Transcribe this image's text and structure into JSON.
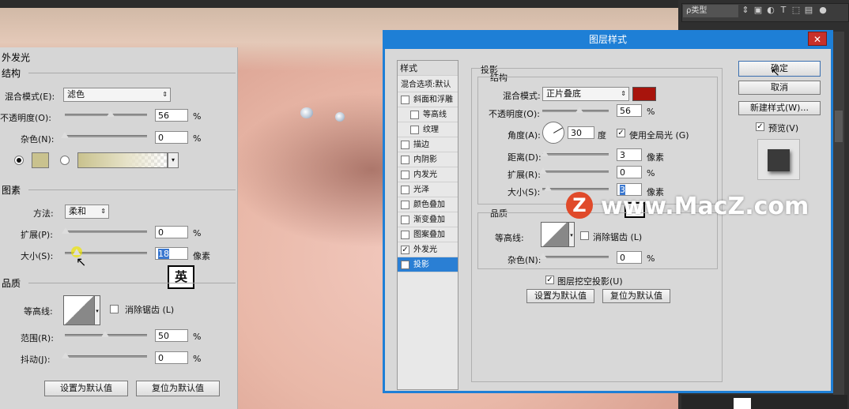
{
  "left_panel": {
    "title": "外发光",
    "structure_title": "结构",
    "blend_mode_label": "混合模式(E):",
    "blend_mode_value": "滤色",
    "opacity_label": "不透明度(O):",
    "opacity_value": "56",
    "opacity_unit": "%",
    "opacity_fraction": 0.56,
    "noise_label": "杂色(N):",
    "noise_value": "0",
    "noise_unit": "%",
    "noise_fraction": 0,
    "elements_title": "图素",
    "method_label": "方法:",
    "method_value": "柔和",
    "spread_label": "扩展(P):",
    "spread_value": "0",
    "spread_unit": "%",
    "size_label": "大小(S):",
    "size_value": "18",
    "size_unit": "像素",
    "quality_title": "品质",
    "contour_label": "等高线:",
    "antialias_label": "消除锯齿 (L)",
    "range_label": "范围(R):",
    "range_value": "50",
    "range_unit": "%",
    "jitter_label": "抖动(J):",
    "jitter_value": "0",
    "jitter_unit": "%",
    "set_default_label": "设置为默认值",
    "reset_default_label": "复位为默认值",
    "ime_label": "英"
  },
  "dialog": {
    "title": "图层样式",
    "styles_header": "样式",
    "styles": [
      {
        "label": "混合选项:默认",
        "checkbox": false,
        "checked": false,
        "selected": false,
        "indent": false
      },
      {
        "label": "斜面和浮雕",
        "checkbox": true,
        "checked": false,
        "selected": false,
        "indent": false
      },
      {
        "label": "等高线",
        "checkbox": true,
        "checked": false,
        "selected": false,
        "indent": true
      },
      {
        "label": "纹理",
        "checkbox": true,
        "checked": false,
        "selected": false,
        "indent": true
      },
      {
        "label": "描边",
        "checkbox": true,
        "checked": false,
        "selected": false,
        "indent": false
      },
      {
        "label": "内阴影",
        "checkbox": true,
        "checked": false,
        "selected": false,
        "indent": false
      },
      {
        "label": "内发光",
        "checkbox": true,
        "checked": false,
        "selected": false,
        "indent": false
      },
      {
        "label": "光泽",
        "checkbox": true,
        "checked": false,
        "selected": false,
        "indent": false
      },
      {
        "label": "颜色叠加",
        "checkbox": true,
        "checked": false,
        "selected": false,
        "indent": false
      },
      {
        "label": "渐变叠加",
        "checkbox": true,
        "checked": false,
        "selected": false,
        "indent": false
      },
      {
        "label": "图案叠加",
        "checkbox": true,
        "checked": false,
        "selected": false,
        "indent": false
      },
      {
        "label": "外发光",
        "checkbox": true,
        "checked": true,
        "selected": false,
        "indent": false
      },
      {
        "label": "投影",
        "checkbox": true,
        "checked": true,
        "selected": true,
        "indent": false
      }
    ],
    "shadow": {
      "title": "投影",
      "structure_title": "结构",
      "blend_mode_label": "混合模式:",
      "blend_mode_value": "正片叠底",
      "shadow_color": "#a8140c",
      "opacity_label": "不透明度(O):",
      "opacity_value": "56",
      "opacity_unit": "%",
      "opacity_fraction": 0.56,
      "angle_label": "角度(A):",
      "angle_value": "30",
      "angle_unit": "度",
      "global_light_label": "使用全局光 (G)",
      "distance_label": "距离(D):",
      "distance_value": "3",
      "distance_unit": "像素",
      "spread_label": "扩展(R):",
      "spread_value": "0",
      "spread_unit": "%",
      "size_label": "大小(S):",
      "size_value": "3",
      "size_unit": "像素",
      "quality_title": "品质",
      "contour_label": "等高线:",
      "antialias_label": "消除锯齿 (L)",
      "noise_label": "杂色(N):",
      "noise_value": "0",
      "noise_unit": "%",
      "knockout_label": "图层挖空投影(U)",
      "set_default_label": "设置为默认值",
      "reset_default_label": "复位为默认值"
    },
    "buttons": {
      "ok": "确定",
      "cancel": "取消",
      "new_style": "新建样式(W)...",
      "preview_label": "预览(V)"
    }
  },
  "right_panel": {
    "search_label": "ρ类型"
  },
  "watermark": {
    "badge": "Z",
    "text": "www.MacZ.com"
  },
  "colors": {
    "dialog_border": "#1e7fd6",
    "selected_item": "#2a7fd4",
    "close_button": "#c8302a",
    "glow_swatch": "#c9c28e"
  }
}
